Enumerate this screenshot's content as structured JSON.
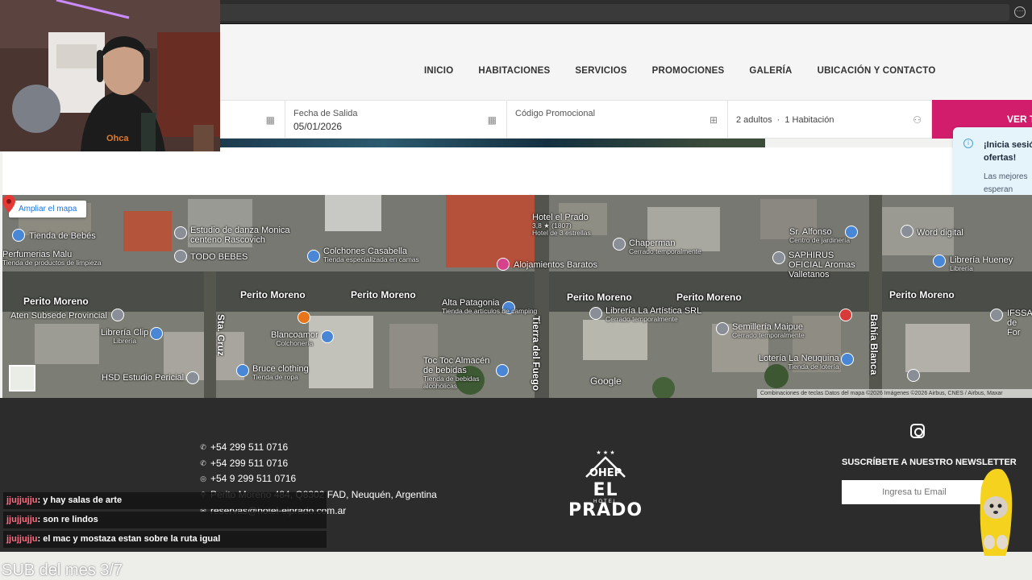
{
  "browser": {
    "url": "r"
  },
  "nav": {
    "items": [
      "INICIO",
      "HABITACIONES",
      "SERVICIOS",
      "PROMOCIONES",
      "GALERÍA",
      "UBICACIÓN Y CONTACTO"
    ]
  },
  "booking": {
    "checkout_label": "Fecha de Salida",
    "checkout_value": "05/01/2026",
    "promo_label": "Código Promocional",
    "guests_adults": "2 adultos",
    "guests_sep": "·",
    "guests_rooms": "1 Habitación",
    "search_button": "VER T"
  },
  "toast": {
    "title_line1": "¡Inicia sesió",
    "title_line2": "ofertas!",
    "body_line1": "Las mejores",
    "body_line2": "esperan"
  },
  "map": {
    "enlarge_button": "Ampliar el mapa",
    "hotel": {
      "name": "Hotel el Prado",
      "rating": "3,8 ★ (1807)",
      "category": "Hotel de 3 estrellas"
    },
    "streets": [
      "Perito Moreno",
      "Perito Moreno",
      "Perito Moreno",
      "Perito Moreno",
      "Perito Moreno",
      "Perito Moreno",
      "Tierra del Fuego",
      "Sta. Cruz",
      "Bahía Blanca"
    ],
    "places": [
      {
        "name": "Tienda de Bebés",
        "sub": ""
      },
      {
        "name": "Perfumerias Malu",
        "sub": "Tienda de productos de limpieza"
      },
      {
        "name": "Estudio de danza Monica centeno Rascovich",
        "sub": ""
      },
      {
        "name": "TODO BEBES",
        "sub": ""
      },
      {
        "name": "Colchones Casabella",
        "sub": "Tienda especializada en camas"
      },
      {
        "name": "Alojamientos Baratos",
        "sub": ""
      },
      {
        "name": "Chaperman",
        "sub": "Cerrado temporalmente"
      },
      {
        "name": "Sr. Alfonso",
        "sub": "Centro de jardinería"
      },
      {
        "name": "SAPHIRUS OFICIAL Aromas Valletanos",
        "sub": ""
      },
      {
        "name": "Word digital",
        "sub": ""
      },
      {
        "name": "Librería Hueney",
        "sub": "Librería"
      },
      {
        "name": "Aten Subsede Provincial",
        "sub": ""
      },
      {
        "name": "Librería Clip",
        "sub": "Librería"
      },
      {
        "name": "Alta Patagonia",
        "sub": "Tienda de artículos de camping"
      },
      {
        "name": "Librería La Artística SRL",
        "sub": "Cerrado temporalmente"
      },
      {
        "name": "Blancoamor",
        "sub": "Colchonería"
      },
      {
        "name": "Semillería Maipue",
        "sub": "Cerrado temporalmente"
      },
      {
        "name": "IFSSA de For",
        "sub": ""
      },
      {
        "name": "Bruce clothing",
        "sub": "Tienda de ropa"
      },
      {
        "name": "Toc Toc Almacén de bebidas",
        "sub": "Tienda de bebidas alcohólicas"
      },
      {
        "name": "Lotería La Neuquina",
        "sub": "Tienda de lotería"
      },
      {
        "name": "HSD Estudio Pericial",
        "sub": ""
      }
    ],
    "google": "Google",
    "attribution": "Combinaciones de teclas    Datos del mapa ©2026 Imágenes ©2026 Airbus, CNES / Airbus, Maxar"
  },
  "footer": {
    "phone1": "+54 299 511 0716",
    "phone2": "+54 299 511 0716",
    "whatsapp": "+54 9 299 511 0716",
    "address": "Perito Moreno 484, Q8302 FAD, Neuquén, Argentina",
    "email": "reservas@hotel-elprado.com.ar",
    "logo_name": "EL PRADO",
    "logo_sub": "HOTEL",
    "newsletter_title": "SUSCRÍBETE A NUESTRO NEWSLETTER",
    "newsletter_placeholder": "Ingresa tu Email"
  },
  "stream": {
    "chat": [
      {
        "user": "jjujjujju",
        "msg": "y hay salas de arte"
      },
      {
        "user": "jjujjujju",
        "msg": "son re lindos"
      },
      {
        "user": "jjujjujju",
        "msg": "el mac y mostaza estan sobre la ruta igual"
      }
    ],
    "sub_text": "SUB del mes 3/7",
    "shirt_text": "Ohca"
  },
  "colors": {
    "accent": "#d11d6b",
    "footer_bg": "#2c2c2c",
    "map_link": "#1a73e8"
  }
}
